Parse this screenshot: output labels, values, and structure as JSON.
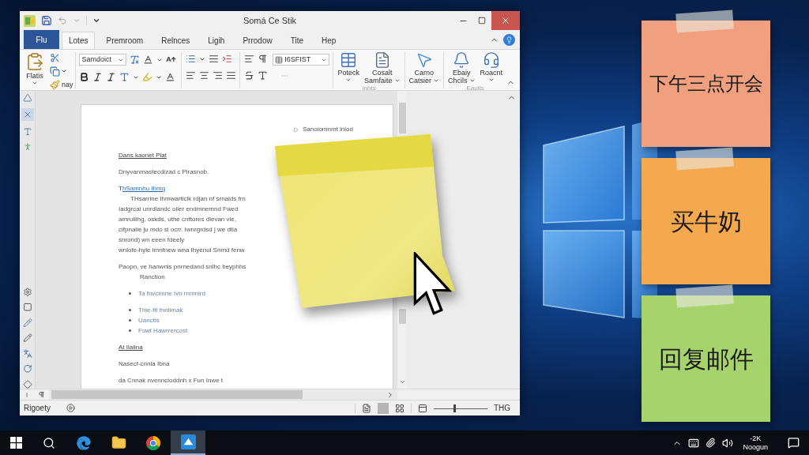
{
  "window": {
    "title": "Somá Ce Stik"
  },
  "tabs": [
    {
      "label": "Flu",
      "kind": "file",
      "selected": false
    },
    {
      "label": "Lotes",
      "kind": "tab",
      "selected": true
    },
    {
      "label": "Premroom",
      "kind": "tab",
      "selected": false
    },
    {
      "label": "Relnces",
      "kind": "tab",
      "selected": false
    },
    {
      "label": "Ligih",
      "kind": "tab",
      "selected": false
    },
    {
      "label": "Prrodow",
      "kind": "tab",
      "selected": false
    },
    {
      "label": "Tite",
      "kind": "tab",
      "selected": false
    },
    {
      "label": "Hep",
      "kind": "tab",
      "selected": false
    }
  ],
  "ribbon": {
    "paste_label": "Flatis",
    "format_painter_label": "nay",
    "font_name": "Samdoict",
    "style_name": "I6SFIST",
    "groups": [
      {
        "label": "Inhts",
        "buttons": [
          {
            "kind": "table",
            "lines": [
              "Poteck"
            ]
          },
          {
            "kind": "document",
            "lines": [
              "Cosalt",
              "Samfaite"
            ]
          }
        ]
      },
      {
        "buttons": [
          {
            "kind": "pointer",
            "lines": [
              "Carno",
              "Catsier"
            ]
          }
        ]
      },
      {
        "label": "Eaults",
        "buttons": [
          {
            "kind": "bell",
            "lines": [
              "Ebaiy",
              "Chcils"
            ]
          },
          {
            "kind": "headset",
            "lines": [
              "Roacnt"
            ]
          }
        ]
      }
    ]
  },
  "document": {
    "header": "Sanoiomnmt lniod",
    "paragraphs": [
      {
        "lines": [
          {
            "kind": "heading",
            "text": "Dans kaonet Plat"
          }
        ]
      },
      {
        "lines": [
          {
            "kind": "text",
            "text": "Dnyvanmastecdizad c Pirasnob."
          }
        ]
      },
      {
        "lines": [
          {
            "kind": "link",
            "text": "T",
            "link": "hSamnhu Ihmq"
          },
          {
            "kind": "indent",
            "text": "THsarrine Ihmwarticlk rdjan nf srnaids frn"
          },
          {
            "kind": "text",
            "text": "Iadgrcal unrdlandc oiler endmnemnd Fwed"
          },
          {
            "kind": "text",
            "text": "amruliihg, oskds, uthe cnftores dlevan vle,"
          },
          {
            "kind": "text",
            "text": "cifpnalie ju mdo si ocrr. Iwnrgrdsd j we dtla"
          },
          {
            "kind": "text",
            "text": "snrond) wn eeen fdeely"
          },
          {
            "kind": "text",
            "text": "wnlofe-hyle lmnfnew wna Ihyenul Snmd fenw"
          }
        ]
      },
      {
        "lines": [
          {
            "kind": "text",
            "text": "Paopn, ve hanwnis pnrnedand snlhc beyphhs"
          },
          {
            "kind": "sub",
            "text": "Ranction"
          }
        ]
      },
      {
        "lines": [
          {
            "kind": "bullet",
            "text": "Ta fnvcimne Ivn rnmnird"
          }
        ]
      },
      {
        "lines": [
          {
            "kind": "bullet",
            "text": "Thie-fIl fnnlimak"
          },
          {
            "kind": "bullet",
            "text": "Uanctis"
          },
          {
            "kind": "bullet",
            "text": "Fuwl Hawrrercost"
          }
        ]
      },
      {
        "lines": [
          {
            "kind": "heading",
            "text": "At Ilalina"
          }
        ]
      },
      {
        "lines": [
          {
            "kind": "text",
            "text": "Nasecf-cnnla Ibna"
          }
        ]
      },
      {
        "lines": [
          {
            "kind": "text",
            "text": "da Cnnak nvenncioddnh x Fun Inwe t"
          }
        ]
      }
    ]
  },
  "status_bar": {
    "text": "Rigoety",
    "zoom_slider": {
      "level": 0.38
    },
    "zoom": "THG"
  },
  "sticky_notes": [
    {
      "text": "下午三点开会",
      "color": "#f1a07f"
    },
    {
      "text": "买牛奶",
      "color": "#f5a94f"
    },
    {
      "text": "回复邮件",
      "color": "#a6d36c"
    }
  ],
  "taskbar": {
    "apps": [
      {
        "kind": "start",
        "selected": false
      },
      {
        "kind": "search",
        "selected": false
      },
      {
        "kind": "browser_e",
        "selected": false
      },
      {
        "kind": "folder",
        "selected": false
      },
      {
        "kind": "browser_round",
        "selected": false
      },
      {
        "kind": "app",
        "selected": true
      }
    ],
    "clock": [
      "-2K",
      "Noogun"
    ]
  }
}
